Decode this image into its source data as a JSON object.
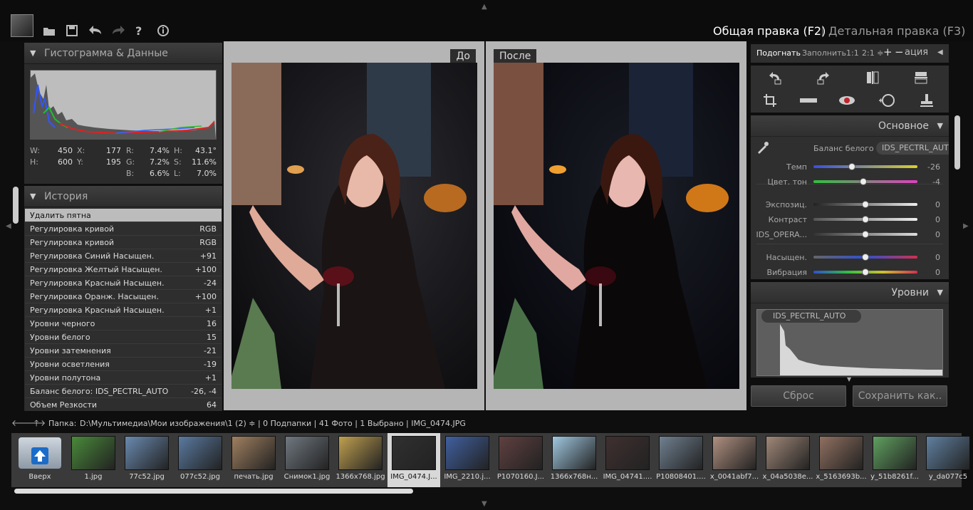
{
  "toolbar": {
    "icons": [
      "open-folder-icon",
      "save-icon",
      "undo-icon",
      "redo-icon",
      "help-icon",
      "info-icon"
    ]
  },
  "modes": {
    "general": "Общая правка (F2)",
    "detail": "Детальная правка (F3)"
  },
  "histogram_panel": {
    "title": "Гистограмма & Данные",
    "stats": {
      "w_label": "W:",
      "w": "450",
      "x_label": "X:",
      "x": "177",
      "r_label": "R:",
      "r": "7.4%",
      "h_label": "H:",
      "h": "43.1°",
      "hh_label": "H:",
      "hh": "600",
      "y_label": "Y:",
      "y": "195",
      "g_label": "G:",
      "g": "7.2%",
      "s_label": "S:",
      "s": "11.6%",
      "b_label": "B:",
      "b": "6.6%",
      "l_label": "L:",
      "l": "7.0%"
    }
  },
  "history_panel": {
    "title": "История",
    "items": [
      {
        "label": "Удалить пятна",
        "value": ""
      },
      {
        "label": "Регулировка кривой",
        "value": "RGB"
      },
      {
        "label": "Регулировка кривой",
        "value": "RGB"
      },
      {
        "label": "Регулировка Синий Насыщен.",
        "value": "+91"
      },
      {
        "label": "Регулировка Желтый Насыщен.",
        "value": "+100"
      },
      {
        "label": "Регулировка Красный Насыщен.",
        "value": "-24"
      },
      {
        "label": "Регулировка Оранж. Насыщен.",
        "value": "+100"
      },
      {
        "label": "Регулировка Красный Насыщен.",
        "value": "+1"
      },
      {
        "label": "Уровни черного",
        "value": "16"
      },
      {
        "label": "Уровни белого",
        "value": "15"
      },
      {
        "label": "Уровни затемнения",
        "value": "-21"
      },
      {
        "label": "Уровни осветления",
        "value": "-19"
      },
      {
        "label": "Уровни полутона",
        "value": "+1"
      },
      {
        "label": "Баланс белого: IDS_PECTRL_AUTO",
        "value": "-26, -4"
      },
      {
        "label": "Объем Резкости",
        "value": "64"
      }
    ]
  },
  "panes": {
    "before": "До",
    "after": "После"
  },
  "view_controls": {
    "fit": "Подогнать",
    "fill": "Заполнить",
    "one_to_one": "1:1",
    "two_to_one": "2:1 ≑",
    "plus": "+",
    "minus": "−",
    "rest": "ация"
  },
  "basic_panel": {
    "title": "Основное",
    "wb_label": "Баланс белого",
    "wb_value": "IDS_PECTRL_AUTO",
    "sliders": [
      {
        "label": "Темп",
        "value": "-26",
        "level": -0.26
      },
      {
        "label": "Цвет. тон",
        "value": "-4",
        "level": -0.04
      },
      {
        "label": "Экспозиц.",
        "value": "0",
        "level": 0
      },
      {
        "label": "Контраст",
        "value": "0",
        "level": 0
      },
      {
        "label": "IDS_OPERA...",
        "value": "0",
        "level": 0
      },
      {
        "label": "Насыщен.",
        "value": "0",
        "level": 0
      },
      {
        "label": "Вибрация",
        "value": "0",
        "level": 0
      }
    ]
  },
  "levels_panel": {
    "title": "Уровни",
    "preset": "IDS_PECTRL_AUTO"
  },
  "buttons": {
    "reset": "Сброс",
    "save_as": "Сохранить как.."
  },
  "status": {
    "folder_label": "Папка:",
    "path": "D:\\Мультимедиа\\Мои изображения\\1 (2) ≑ | 0 Подпапки | 41 Фото | 1 Выбрано | IMG_0474.JPG"
  },
  "filmstrip": {
    "up_label": "Вверх",
    "items": [
      "1.jpg",
      "77c52.jpg",
      "077c52.jpg",
      "печать.jpg",
      "Снимок1.jpg",
      "1366x768.jpg",
      "IMG_0474.J...",
      "IMG_2210.j...",
      "P1070160.J...",
      "1366x768н...",
      "IMG_04741....",
      "P10808401....",
      "x_0041abf7...",
      "x_04a5038e...",
      "x_5163693b...",
      "y_51b8261f...",
      "y_da077c5"
    ]
  },
  "colors": {
    "accent": "#bcbcbc",
    "background": "#0e0e0e",
    "panel": "#2b2b2b"
  }
}
